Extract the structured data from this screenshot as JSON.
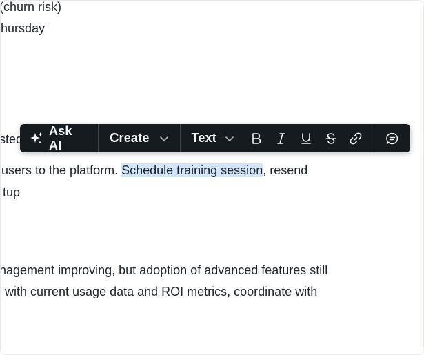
{
  "document": {
    "lines": [
      "churn risk)",
      "ursday",
      "ted",
      " users to the platform. ",
      "tup",
      "agement improving, but adoption of advanced features still",
      " with current usage data and ROI metrics, coordinate with"
    ],
    "highlighted_text": "Schedule training session",
    "after_highlight": ", resend",
    "highlight_color": "#d3e5fa"
  },
  "toolbar": {
    "ask_ai_label": "Ask AI",
    "create_label": "Create",
    "text_label": "Text",
    "buttons": [
      "bold-icon",
      "italic-icon",
      "underline-icon",
      "strikethrough-icon",
      "link-icon",
      "comment-icon"
    ],
    "background": "#161b1f"
  }
}
